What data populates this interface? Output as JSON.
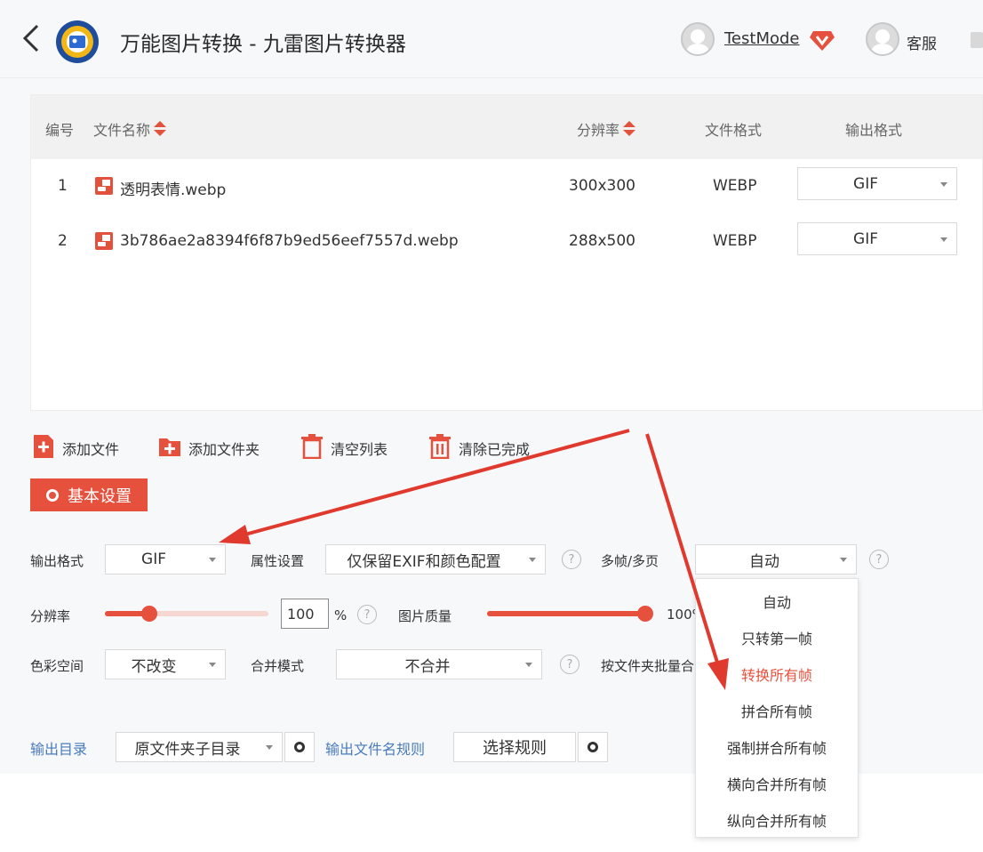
{
  "header": {
    "title": "万能图片转换 - 九雷图片转换器",
    "user_name": "TestMode",
    "service_label": "客服"
  },
  "table": {
    "columns": {
      "index": "编号",
      "file_name": "文件名称",
      "resolution": "分辨率",
      "file_format": "文件格式",
      "output_format": "输出格式"
    },
    "rows": [
      {
        "index": "1",
        "name": "透明表情.webp",
        "resolution": "300x300",
        "format": "WEBP",
        "output": "GIF"
      },
      {
        "index": "2",
        "name": "3b786ae2a8394f6f87b9ed56eef7557d.webp",
        "resolution": "288x500",
        "format": "WEBP",
        "output": "GIF"
      }
    ]
  },
  "toolbar": {
    "add_file": "添加文件",
    "add_folder": "添加文件夹",
    "clear_list": "清空列表",
    "clear_done": "清除已完成"
  },
  "settings": {
    "basic_label": "基本设置",
    "output_format_label": "输出格式",
    "output_format_value": "GIF",
    "attr_label": "属性设置",
    "attr_value": "仅保留EXIF和颜色配置",
    "multiframe_label": "多帧/多页",
    "multiframe_value": "自动",
    "resolution_label": "分辨率",
    "resolution_value": "100",
    "resolution_unit": "%",
    "resolution_level": 0.27,
    "quality_label": "图片质量",
    "quality_value": "100%",
    "quality_level": 1.0,
    "color_space_label": "色彩空间",
    "color_space_value": "不改变",
    "merge_label": "合并模式",
    "merge_value": "不合并",
    "batch_label": "按文件夹批量合",
    "output_dir_label": "输出目录",
    "output_dir_value": "原文件夹子目录",
    "filename_rule_label": "输出文件名规则",
    "choose_rule": "选择规则",
    "help": "?"
  },
  "dropdown": {
    "items": [
      "自动",
      "只转第一帧",
      "转换所有帧",
      "拼合所有帧",
      "强制拼合所有帧",
      "横向合并所有帧",
      "纵向合并所有帧"
    ],
    "active_index": 2
  },
  "colors": {
    "accent": "#e6513e",
    "arrow": "#e03a2e",
    "link": "#4a7bbd"
  }
}
